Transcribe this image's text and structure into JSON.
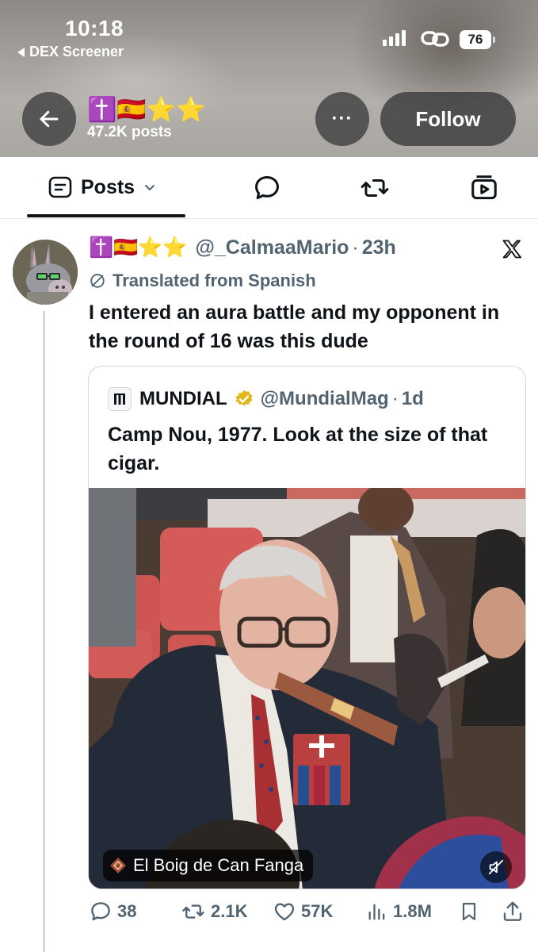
{
  "status_bar": {
    "time": "10:18",
    "back_app": "DEX Screener",
    "battery": "76"
  },
  "profile_header": {
    "name_emoji": "✝️🇪🇸⭐⭐",
    "posts_count": "47.2K posts",
    "more_label": "···",
    "follow_label": "Follow"
  },
  "tabs": {
    "posts_label": "Posts",
    "icons": [
      "replies-bubble-icon",
      "repost-icon",
      "media-video-icon"
    ]
  },
  "post": {
    "name_emoji": "✝️🇪🇸⭐⭐",
    "handle": "@_CalmaaMario",
    "separator": "·",
    "time": "23h",
    "translated": "Translated from Spanish",
    "text": "I entered an aura battle and my opponent in the round of 16 was this dude",
    "quote": {
      "name": "MUNDIAL",
      "handle": "@MundialMag",
      "separator": "·",
      "time": "1d",
      "text": "Camp Nou, 1977. Look at the size of that cigar.",
      "media_label": "El Boig de Can Fanga"
    },
    "actions": {
      "replies": "38",
      "reposts": "2.1K",
      "likes": "57K",
      "views": "1.8M"
    }
  },
  "colors": {
    "text_primary": "#0f1419",
    "text_secondary": "#536471",
    "border": "#cfd9de",
    "verified_gold": "#e2b719"
  }
}
